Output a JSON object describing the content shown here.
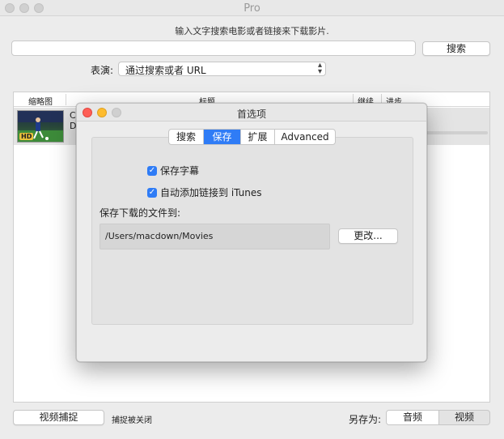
{
  "window": {
    "title": "Pro"
  },
  "search": {
    "hint": "输入文字搜索电影或者链接来下载影片.",
    "input_value": "",
    "button_label": "搜索"
  },
  "mode": {
    "label": "表演:",
    "selected": "通过搜索或者 URL"
  },
  "table": {
    "columns": [
      "缩略图",
      "标题",
      "继续",
      "进步"
    ],
    "rows": [
      {
        "title_line1": "C",
        "title_line2": "D"
      }
    ]
  },
  "bottom": {
    "capture_button": "视频捕捉",
    "capture_status": "捕捉被关闭",
    "save_as_label": "另存为:",
    "save_options": [
      "音频",
      "视频"
    ],
    "selected_option": "音频"
  },
  "dialog": {
    "title": "首选项",
    "tabs": [
      "搜索",
      "保存",
      "扩展",
      "Advanced"
    ],
    "active_tab": "保存",
    "save_subtitles": "保存字幕",
    "auto_add_itunes": "自动添加链接到 iTunes",
    "save_path_label": "保存下载的文件到:",
    "save_path": "/Users/macdown/Movies",
    "change_button": "更改..."
  },
  "colors": {
    "accent": "#2f7cf6",
    "close": "#fe5f57",
    "minimize": "#febc2e",
    "zoom_inactive": "#d0d0d0"
  }
}
